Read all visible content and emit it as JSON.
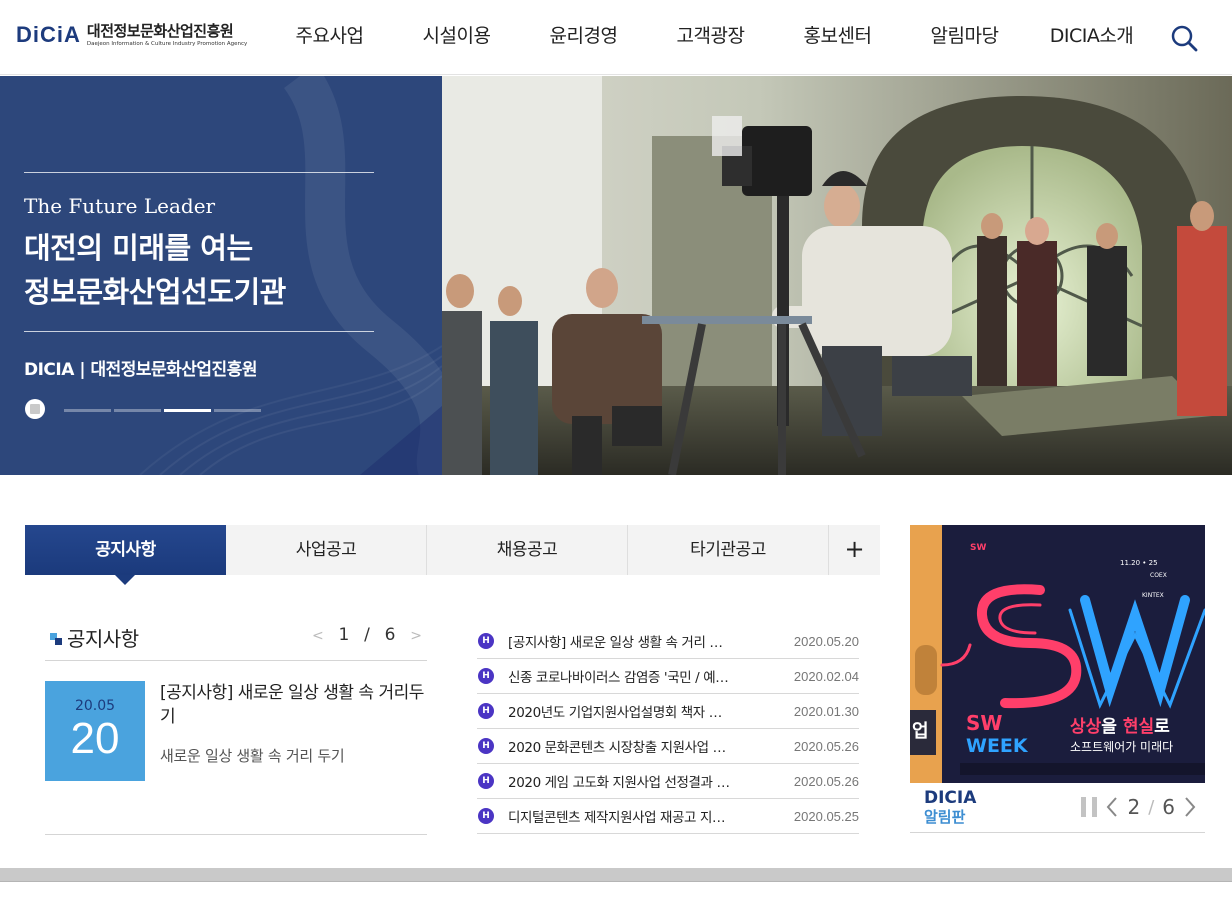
{
  "header": {
    "logo_mark": "DiCiA",
    "logo_name": "대전정보문화산업진흥원",
    "logo_english": "Daejeon Information & Culture Industry Promotion Agency",
    "nav": [
      "주요사업",
      "시설이용",
      "윤리경영",
      "고객광장",
      "홍보센터",
      "알림마당",
      "DICIA소개"
    ],
    "search_icon": "search-icon"
  },
  "hero": {
    "subtitle": "The Future Leader",
    "title_line1": "대전의 미래를 여는",
    "title_line2": "정보문화산업선도기관",
    "org": "DICIA | 대전정보문화산업진흥원",
    "slide_count": 4,
    "active_slide": 3
  },
  "tabs": {
    "items": [
      "공지사항",
      "사업공고",
      "채용공고",
      "타기관공고"
    ],
    "more": "+",
    "active": 0
  },
  "featured": {
    "section_title": "공지사항",
    "page_current": "1",
    "page_sep": "/",
    "page_total": "6",
    "prev": "<",
    "next": ">",
    "date_ym": "20.05",
    "date_day": "20",
    "item_title": "[공지사항] 새로운 일상 생활 속 거리두기",
    "item_desc": "새로운 일상 생활 속 거리 두기"
  },
  "notices": [
    {
      "badge": "H",
      "title": "[공지사항] 새로운 일상 생활 속 거리 …",
      "date": "2020.05.20"
    },
    {
      "badge": "H",
      "title": "신종 코로나바이러스 감염증 '국민 / 예…",
      "date": "2020.02.04"
    },
    {
      "badge": "H",
      "title": "2020년도 기업지원사업설명회 책자 …",
      "date": "2020.01.30"
    },
    {
      "badge": "H",
      "title": "2020 문화콘텐츠 시장창출 지원사업 …",
      "date": "2020.05.26"
    },
    {
      "badge": "H",
      "title": "2020 게임 고도화 지원사업 선정결과 …",
      "date": "2020.05.26"
    },
    {
      "badge": "H",
      "title": "디지털콘텐츠 제작지원사업 재공고 지…",
      "date": "2020.05.25"
    }
  ],
  "banner": {
    "date_text": "11.20 • 25",
    "venue1": "COEX",
    "venue2": "KINTEX",
    "big_text": "SW",
    "sw_line1": "SW",
    "sw_line2": "WEEK",
    "slogan_a": "상상",
    "slogan_b": "을 ",
    "slogan_c": "현실",
    "slogan_d": "로",
    "slogan2": "소프트웨어가 미래다",
    "side_text": "업",
    "label_line1": "DICIA",
    "label_line2": "알림판",
    "page_current": "2",
    "page_sep": "/",
    "page_total": "6"
  },
  "colors": {
    "brand_navy": "#1c3b7d",
    "hero_panel": "#2d477b",
    "date_box": "#4aa3de",
    "badge": "#4b35c4"
  }
}
